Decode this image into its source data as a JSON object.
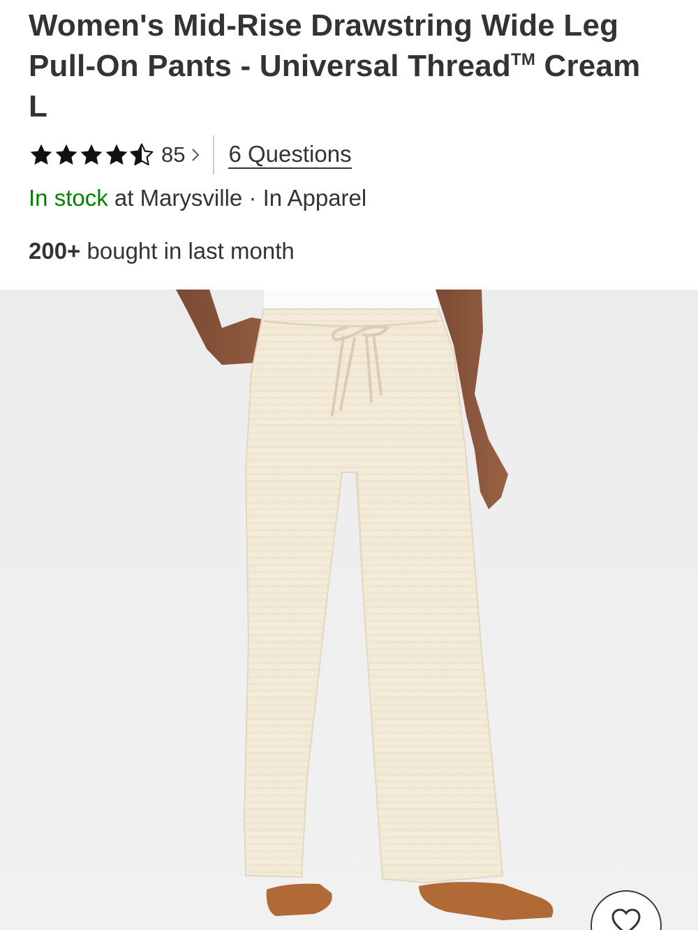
{
  "product": {
    "title_main": "Women's Mid-Rise Drawstring Wide Leg Pull-On Pants - Universal Thread",
    "title_tm": "TM",
    "title_variant": "Cream L"
  },
  "rating": {
    "stars": 4.5,
    "max_stars": 5,
    "count": "85",
    "questions_label": "6 Questions"
  },
  "availability": {
    "status": "In stock",
    "location_text": "at Marysville",
    "separator": "·",
    "department": "In Apparel"
  },
  "social_proof": {
    "count": "200+",
    "text": "bought in last month"
  },
  "image": {
    "subject": "model wearing cream wide leg pull-on pants",
    "background_color": "#eeeeee",
    "pants_color": "#f3ead8"
  },
  "favorite": {
    "icon": "heart-icon"
  },
  "colors": {
    "stock_green": "#008300",
    "text": "#333333",
    "divider": "#cccccc"
  }
}
